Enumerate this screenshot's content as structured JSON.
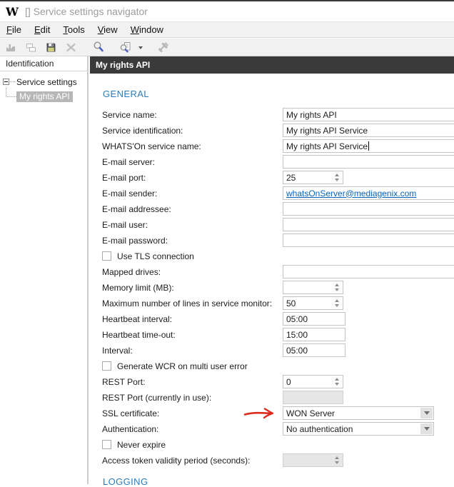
{
  "window": {
    "logo": "W",
    "title": "[] Service settings navigator"
  },
  "menubar": {
    "items": [
      "File",
      "Edit",
      "Tools",
      "View",
      "Window"
    ]
  },
  "toolbar": {
    "icons": [
      "build-icon",
      "cascade-windows-icon",
      "save-icon",
      "delete-icon",
      "search-icon",
      "search-document-icon",
      "tools-icon"
    ]
  },
  "sidebar": {
    "header": "Identification",
    "tree": {
      "parent": "Service settings",
      "child": "My rights API",
      "child_selected": true
    }
  },
  "content": {
    "panel_title": "My rights API",
    "section_general": "GENERAL",
    "section_logging": "LOGGING",
    "accent_blue": "#2b7cbe",
    "link_color": "#0563c1",
    "annotation_color": "#dd2b20",
    "selected_tree_bg": "#b7b7b7",
    "panel_header_bg": "#3a3a3a"
  },
  "form": {
    "rows": [
      {
        "name": "service-name",
        "type": "text",
        "label": "Service name:",
        "value": "My rights API"
      },
      {
        "name": "service-identification",
        "type": "text",
        "label": "Service identification:",
        "value": "My rights API Service"
      },
      {
        "name": "whatson-service-name",
        "type": "text",
        "label": "WHATS'On service name:",
        "value": "My rights API Service",
        "caret": true
      },
      {
        "name": "email-server",
        "type": "text",
        "label": "E-mail server:",
        "value": ""
      },
      {
        "name": "email-port",
        "type": "spin",
        "label": "E-mail port:",
        "value": "25"
      },
      {
        "name": "email-sender",
        "type": "link",
        "label": "E-mail sender:",
        "value": "whatsOnServer@mediagenix.com"
      },
      {
        "name": "email-addressee",
        "type": "text",
        "label": "E-mail addressee:",
        "value": ""
      },
      {
        "name": "email-user",
        "type": "text",
        "label": "E-mail user:",
        "value": ""
      },
      {
        "name": "email-password",
        "type": "text",
        "label": "E-mail password:",
        "value": ""
      },
      {
        "name": "use-tls-connection",
        "type": "checkbox",
        "label": "Use TLS connection",
        "checked": false
      },
      {
        "name": "mapped-drives",
        "type": "text",
        "label": "Mapped drives:",
        "value": ""
      },
      {
        "name": "memory-limit",
        "type": "spin",
        "label": "Memory limit (MB):",
        "value": ""
      },
      {
        "name": "max-lines-service-monitor",
        "type": "spin",
        "label": "Maximum number of lines in service monitor:",
        "value": "50"
      },
      {
        "name": "heartbeat-interval",
        "type": "time",
        "label": "Heartbeat interval:",
        "value": "05:00"
      },
      {
        "name": "heartbeat-timeout",
        "type": "time",
        "label": "Heartbeat time-out:",
        "value": "15:00"
      },
      {
        "name": "interval",
        "type": "time",
        "label": "Interval:",
        "value": "05:00"
      },
      {
        "name": "generate-wcr",
        "type": "checkbox",
        "label": "Generate WCR on multi user error",
        "checked": false
      },
      {
        "name": "rest-port",
        "type": "spin",
        "label": "REST Port:",
        "value": "0"
      },
      {
        "name": "rest-port-in-use",
        "type": "disabled",
        "label": "REST Port (currently in use):",
        "value": ""
      },
      {
        "name": "ssl-certificate",
        "type": "dropdown",
        "label": "SSL certificate:",
        "value": "WON Server",
        "annotated": true
      },
      {
        "name": "authentication",
        "type": "dropdown",
        "label": "Authentication:",
        "value": "No authentication"
      },
      {
        "name": "never-expire",
        "type": "checkbox",
        "label": "Never expire",
        "checked": false
      },
      {
        "name": "access-token-validity",
        "type": "disabled-spin",
        "label": "Access token validity period (seconds):",
        "value": ""
      }
    ]
  }
}
